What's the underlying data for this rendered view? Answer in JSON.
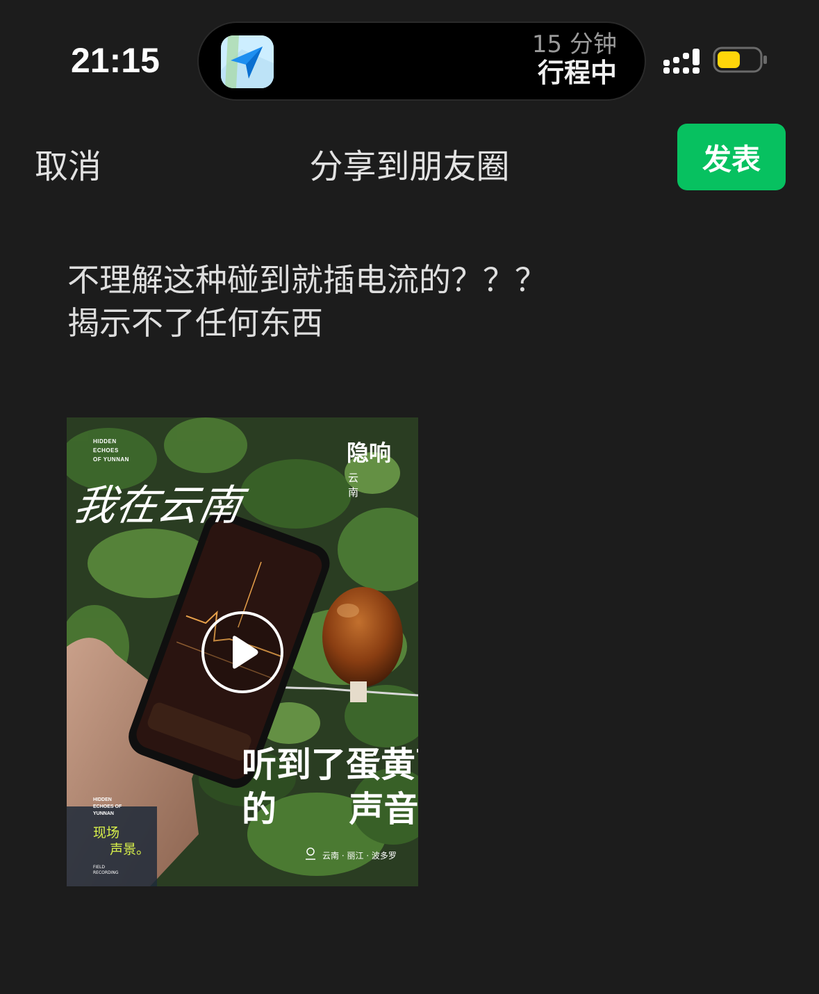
{
  "status_bar": {
    "time": "21:15",
    "live_activity": {
      "app_icon": "navigation-arrow-icon",
      "eta": "15 分钟",
      "status": "行程中"
    },
    "signal_icon": "cellular-signal-icon",
    "battery_icon": "battery-icon",
    "battery_color": "#ffd60a"
  },
  "header": {
    "cancel_label": "取消",
    "title": "分享到朋友圈",
    "publish_label": "发表",
    "publish_color": "#07c160"
  },
  "post": {
    "text": "不理解这种碰到就插电流的？？？\n揭示不了任何东西"
  },
  "video": {
    "play_icon": "play-icon",
    "poster": {
      "small_caption": "HIDDEN\nECHOES\nOF YUNNAN",
      "brand": "隐响",
      "brand_sub": "云南",
      "script_title": "我在云南",
      "headline": "听到了蛋黄菌\n的      声音",
      "location": "云南 · 丽江 · 波多罗",
      "tag_small": "HIDDEN\nECHOES OF\nYUNNAN",
      "tag": "现场\n    声景。",
      "tag_fine": "FIELD\nRECORDING"
    }
  }
}
